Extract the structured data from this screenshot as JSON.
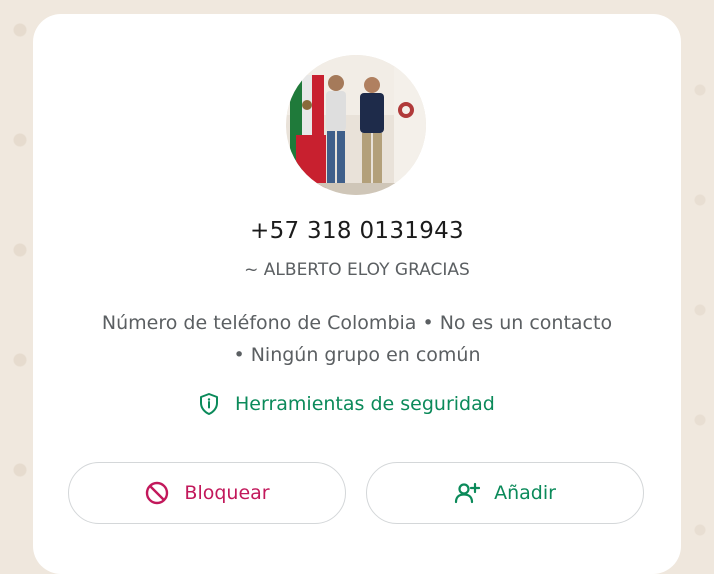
{
  "profile": {
    "phone": "+57 318 0131943",
    "display_name": "~ ALBERTO ELOY GRACIAS",
    "info_line1": "Número de teléfono de Colombia • No es un contacto",
    "info_line2": "• Ningún grupo en común"
  },
  "security": {
    "label": "Herramientas de seguridad",
    "icon": "shield-icon"
  },
  "actions": {
    "block_label": "Bloquear",
    "block_icon": "block-icon",
    "add_label": "Añadir",
    "add_icon": "add-person-icon"
  },
  "colors": {
    "accent_green": "#0b8a5a",
    "danger_pink": "#c2185b",
    "text_primary": "#1b1b1b",
    "text_secondary": "#5b5f62"
  }
}
